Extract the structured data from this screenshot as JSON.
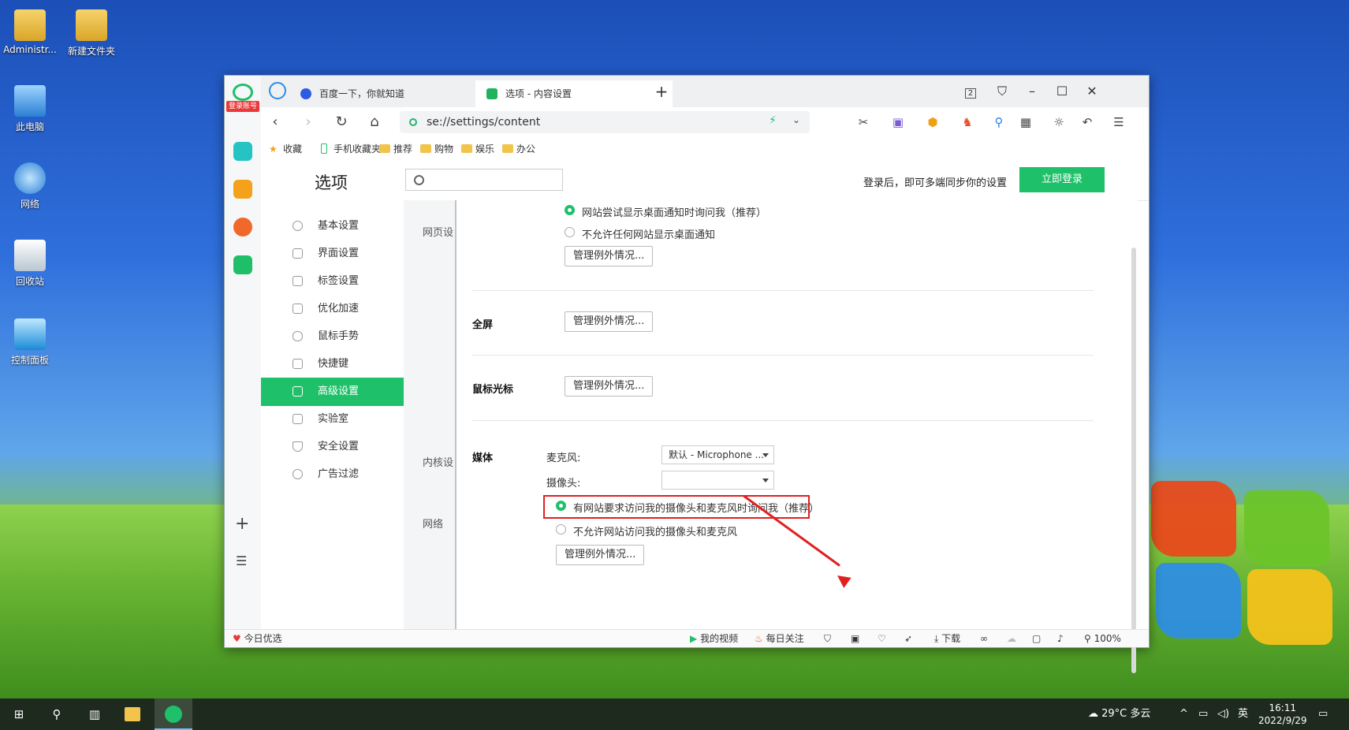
{
  "desktop": {
    "icons": [
      {
        "label": "Administr..."
      },
      {
        "label": "新建文件夹"
      },
      {
        "label": "此电脑"
      },
      {
        "label": "网络"
      },
      {
        "label": "回收站"
      },
      {
        "label": "控制面板"
      }
    ]
  },
  "sidebar": {
    "login_badge": "登录账号"
  },
  "tabs": [
    {
      "label": "百度一下，你就知道"
    },
    {
      "label": "选项 - 内容设置"
    }
  ],
  "tab_counter": "2",
  "address": {
    "url": "se://settings/content"
  },
  "bookmarks": [
    "收藏",
    "手机收藏夹",
    "推荐",
    "购物",
    "娱乐",
    "办公"
  ],
  "settings": {
    "title": "选项",
    "login_tip": "登录后，即可多端同步你的设置",
    "login_button": "立即登录",
    "menu": [
      "基本设置",
      "界面设置",
      "标签设置",
      "优化加速",
      "鼠标手势",
      "快捷键",
      "高级设置",
      "实验室",
      "安全设置",
      "广告过滤"
    ],
    "active_menu": "高级设置",
    "sections": [
      "网页设",
      "内核设",
      "网络"
    ],
    "notifications": {
      "option_ask": "网站尝试显示桌面通知时询问我（推荐）",
      "option_deny": "不允许任何网站显示桌面通知"
    },
    "manage_button": "管理例外情况...",
    "fullscreen_label": "全屏",
    "mouse_cursor_label": "鼠标光标",
    "media": {
      "label": "媒体",
      "mic_label": "麦克风:",
      "mic_value": "默认 - Microphone ...",
      "camera_label": "摄像头:",
      "camera_value": "",
      "option_ask": "有网站要求访问我的摄像头和麦克风时询问我（推荐）",
      "option_deny": "不允许网站访问我的摄像头和麦克风"
    }
  },
  "statusbar": {
    "left": "今日优选",
    "video": "我的视频",
    "daily": "每日关注",
    "download": "下载",
    "zoom": "100%"
  },
  "taskbar": {
    "weather": "29°C 多云",
    "ime": "英",
    "time": "16:11",
    "date": "2022/9/29"
  }
}
